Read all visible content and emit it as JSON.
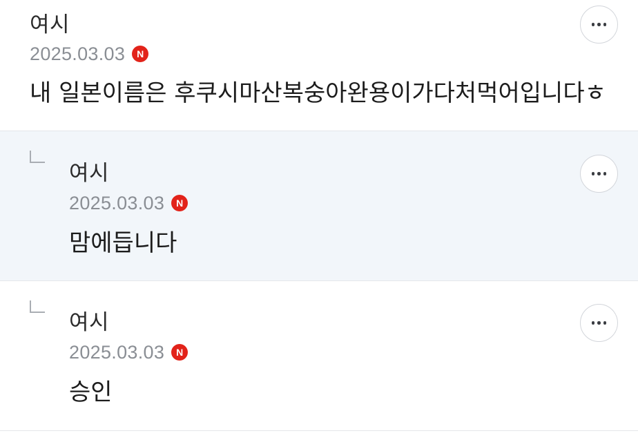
{
  "comments": [
    {
      "author": "여시",
      "date": "2025.03.03",
      "badge": "N",
      "text": "내 일본이름은 후쿠시마산복숭아완용이가다처먹어입니다ㅎ",
      "is_reply": false
    },
    {
      "author": "여시",
      "date": "2025.03.03",
      "badge": "N",
      "text": "맘에듭니다",
      "is_reply": true
    },
    {
      "author": "여시",
      "date": "2025.03.03",
      "badge": "N",
      "text": "승인",
      "is_reply": true
    }
  ],
  "icons": {
    "more": "more-options-icon",
    "reply": "reply-arrow-icon",
    "new": "new-badge-icon"
  },
  "colors": {
    "reply_background": "#f2f6fa",
    "badge": "#e2231a",
    "date": "#8a8e94"
  }
}
